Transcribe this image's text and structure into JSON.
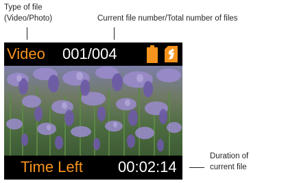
{
  "callouts": {
    "type_line1": "Type of file",
    "type_line2": "(Video/Photo)",
    "count": "Current file number/Total number of files",
    "duration_line1": "Duration of",
    "duration_line2": "current file"
  },
  "screen": {
    "file_type": "Video",
    "file_count": "001/004",
    "time_left_label": "Time Left",
    "duration": "00:02:14",
    "icons": [
      "battery-icon",
      "memory-card-icon"
    ],
    "photo_subject": "lavender-field-photo"
  },
  "colors": {
    "accent": "#f7941d",
    "screen_background": "#000000",
    "screen_text": "#ffffff",
    "callout_text": "#231f20"
  }
}
